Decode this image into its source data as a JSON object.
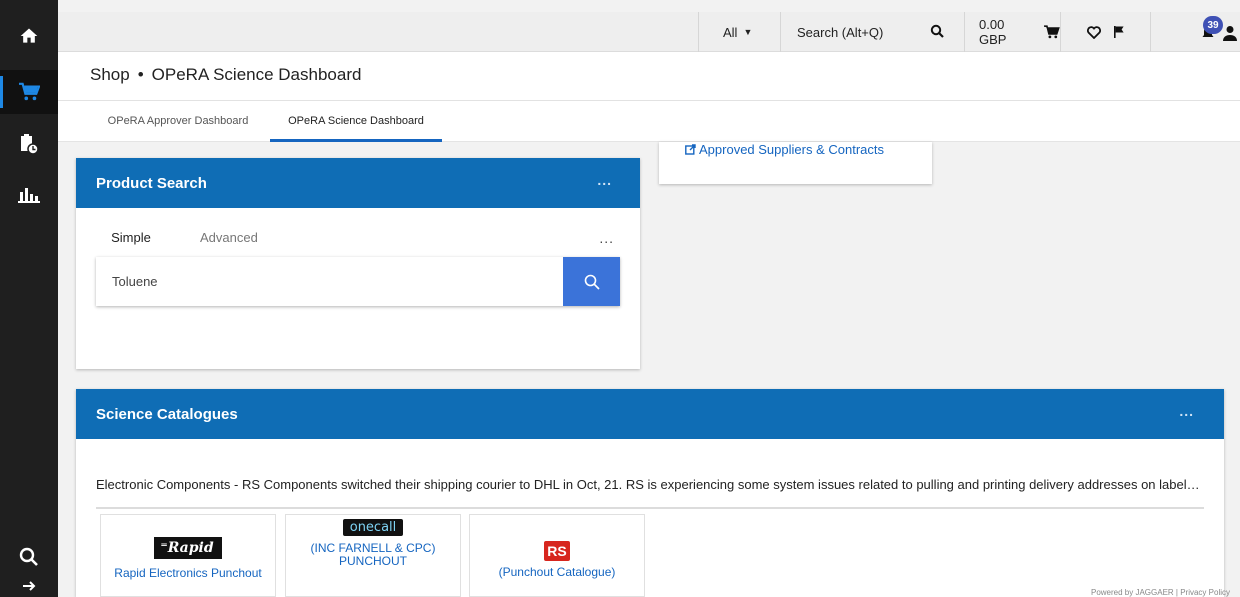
{
  "rail": {
    "items": [
      {
        "name": "home-icon"
      },
      {
        "name": "cart-icon"
      },
      {
        "name": "history-icon"
      },
      {
        "name": "analytics-icon"
      }
    ],
    "bottom": [
      {
        "name": "search-icon"
      },
      {
        "name": "expand-icon"
      }
    ]
  },
  "topbar": {
    "scope": "All",
    "search_placeholder": "Search (Alt+Q)",
    "cart_total": "0.00 GBP",
    "notifications_count": "39"
  },
  "header": {
    "crumb_root": "Shop",
    "crumb_sep": "•",
    "crumb_page": "OPeRA Science Dashboard"
  },
  "tabs": [
    "OPeRA Approver Dashboard",
    "OPeRA Science Dashboard"
  ],
  "product_search": {
    "title": "Product Search",
    "menu": "...",
    "tab_simple": "Simple",
    "tab_advanced": "Advanced",
    "tab_menu": "...",
    "query": "Toluene"
  },
  "approved": {
    "link": "Approved Suppliers & Contracts"
  },
  "catalogues": {
    "title": "Science Catalogues",
    "menu": "...",
    "notice": "Electronic Components - RS Components switched their shipping courier to DHL in Oct, 21. RS is experiencing some system issues related to pulling and printing delivery addresses on labels, so please double check your order.",
    "tiles": [
      {
        "logo": "Rapid",
        "label": "Rapid Electronics Punchout"
      },
      {
        "logo": "onecall",
        "label": "(INC FARNELL & CPC) PUNCHOUT"
      },
      {
        "logo": "RS",
        "label": "(Punchout Catalogue)"
      }
    ]
  },
  "colors": {
    "accent": "#0f6db5",
    "button": "#3b73d9",
    "link": "#1565c0",
    "rail": "#1f1f1f"
  },
  "footer": "Powered by JAGGAER | Privacy Policy"
}
